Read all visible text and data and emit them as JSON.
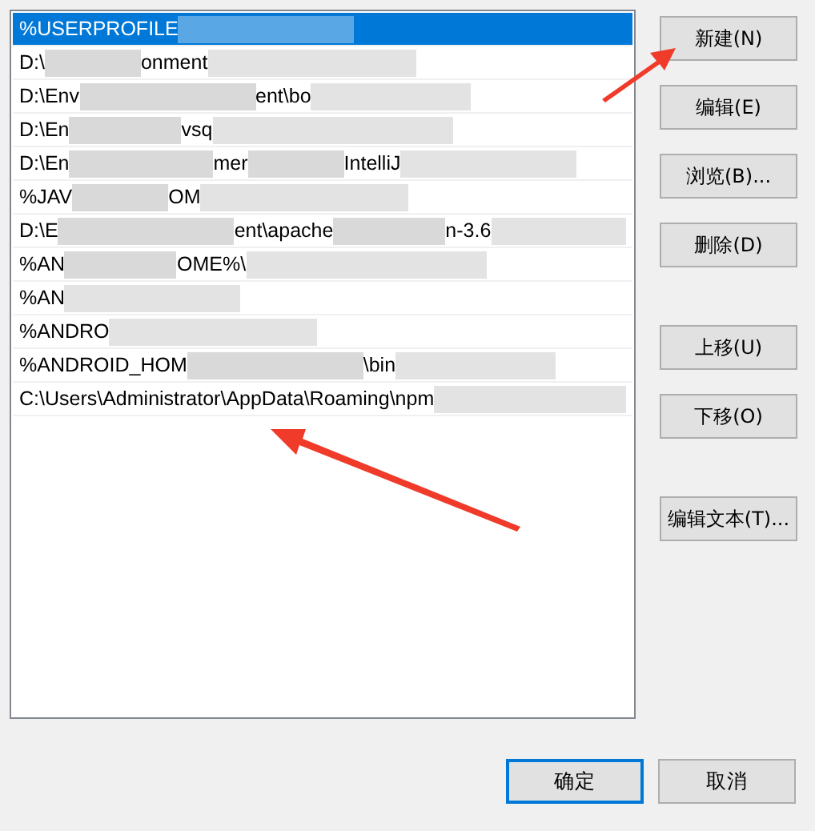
{
  "list": [
    {
      "parts": [
        "%USERPROFILE"
      ],
      "selected": true
    },
    {
      "parts": [
        "D:\\",
        "onment"
      ],
      "selected": false
    },
    {
      "parts": [
        "D:\\Env",
        "ent\\bo"
      ],
      "selected": false
    },
    {
      "parts": [
        "D:\\En",
        "vsq"
      ],
      "selected": false
    },
    {
      "parts": [
        "D:\\En",
        "mer",
        "IntelliJ"
      ],
      "selected": false
    },
    {
      "parts": [
        "%JAV",
        "OM"
      ],
      "selected": false
    },
    {
      "parts": [
        "D:\\E",
        "ent\\apache",
        "n-3.6"
      ],
      "selected": false
    },
    {
      "parts": [
        "%AN",
        "OME%\\"
      ],
      "selected": false
    },
    {
      "parts": [
        "%AN"
      ],
      "selected": false
    },
    {
      "parts": [
        "%ANDRO"
      ],
      "selected": false
    },
    {
      "parts": [
        "%ANDROID_HOM",
        "\\bin"
      ],
      "selected": false
    },
    {
      "parts": [
        "C:\\Users\\Administrator\\AppData\\Roaming\\npm"
      ],
      "selected": false
    }
  ],
  "side_button_groups": [
    [
      "新建(N)",
      "编辑(E)",
      "浏览(B)...",
      "删除(D)"
    ],
    [
      "上移(U)",
      "下移(O)"
    ],
    [
      "编辑文本(T)..."
    ]
  ],
  "footer_buttons": [
    {
      "label": "确定",
      "selected": true
    },
    {
      "label": "取消",
      "selected": false
    }
  ]
}
